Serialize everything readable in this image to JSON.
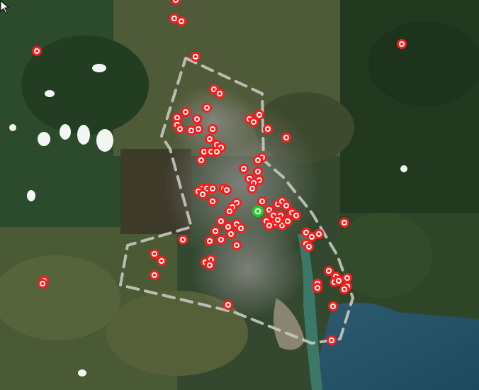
{
  "map": {
    "boundary_color": "#c8c8c0",
    "marker_fill": "#ff1a1a",
    "marker_ring": "#ffffff",
    "selected_marker_fill": "#22cc22",
    "selected_marker_count": 1,
    "marker_count": 120,
    "cursor_icon": "arrow-cursor-icon"
  }
}
